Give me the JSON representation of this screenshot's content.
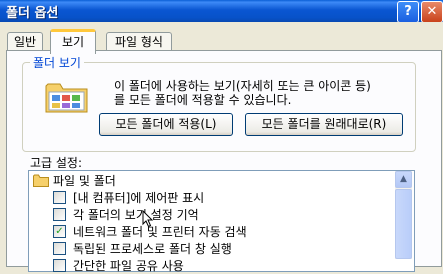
{
  "window": {
    "title": "폴더 옵션"
  },
  "title_buttons": {
    "help": "?",
    "close": "✕"
  },
  "tabs": [
    {
      "label": "일반"
    },
    {
      "label": "보기"
    },
    {
      "label": "파일 형식"
    }
  ],
  "folder_view": {
    "legend": "폴더 보기",
    "description_line1": "이 폴더에 사용하는 보기(자세히 또는 큰 아이콘 등)",
    "description_line2": "를 모든 폴더에 적용할 수 있습니다.",
    "apply_button": "모든 폴더에 적용(L)",
    "reset_button": "모든 폴더를 원래대로(R)"
  },
  "advanced": {
    "label": "고급 설정:",
    "items": [
      {
        "label": "파일 및 폴더",
        "type": "folder"
      },
      {
        "label": "[내 컴퓨터]에 제어판 표시",
        "type": "checkbox",
        "checked": false
      },
      {
        "label": "각 폴더의 보기 설정 기억",
        "type": "checkbox",
        "checked": false
      },
      {
        "label": "네트워크 폴더 및 프린터 자동 검색",
        "type": "checkbox",
        "checked": true
      },
      {
        "label": "독립된 프로세스로 폴더 창 실행",
        "type": "checkbox",
        "checked": false
      },
      {
        "label": "간단한 파일 공유 사용",
        "type": "checkbox",
        "checked": false
      }
    ]
  },
  "colors": {
    "accent": "#0046d5",
    "titlebar": "#0a56d2",
    "tab_highlight": "#ffc83c"
  }
}
